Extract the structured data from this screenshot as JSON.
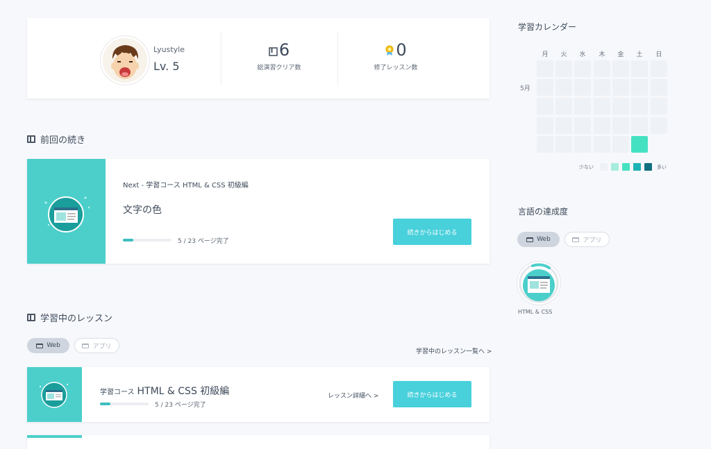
{
  "profile": {
    "username": "Lyustyle",
    "level": "Lv. 5",
    "stats": [
      {
        "icon": "book-icon",
        "value": "6",
        "label": "総演習クリア数"
      },
      {
        "icon": "medal-icon",
        "value": "0",
        "label": "修了レッスン数"
      }
    ]
  },
  "continue_section": {
    "heading": "前回の続き",
    "next_label": "Next - 学習コース HTML & CSS 初級編",
    "lesson_title": "文字の色",
    "progress_text": "5 / 23 ページ完了",
    "progress_fraction": 0.22,
    "button_label": "続きからはじめる"
  },
  "learning_section": {
    "heading": "学習中のレッスン",
    "filters": [
      {
        "label": "Web",
        "active": true
      },
      {
        "label": "アプリ",
        "active": false
      }
    ],
    "list_link": "学習中のレッスン一覧へ >",
    "lessons": [
      {
        "prefix": "学習コース",
        "title": "HTML & CSS 初級編",
        "progress_text": "5 / 23 ページ完了",
        "progress_fraction": 0.22,
        "detail_link": "レッスン詳細へ >",
        "button_label": "続きからはじめる"
      }
    ]
  },
  "calendar": {
    "heading": "学習カレンダー",
    "weekdays": [
      "月",
      "火",
      "水",
      "木",
      "金",
      "土",
      "日"
    ],
    "month_label": "5月",
    "legend_less": "少ない",
    "legend_more": "多い",
    "legend_colors": [
      "#eef1f6",
      "#a7ecdc",
      "#45e2c2",
      "#1db3b5",
      "#11707f"
    ],
    "active_color": "#45e2c2"
  },
  "achievement": {
    "heading": "言語の達成度",
    "filters": [
      {
        "label": "Web",
        "active": true
      },
      {
        "label": "アプリ",
        "active": false
      }
    ],
    "badges": [
      {
        "label": "HTML & CSS"
      }
    ]
  }
}
